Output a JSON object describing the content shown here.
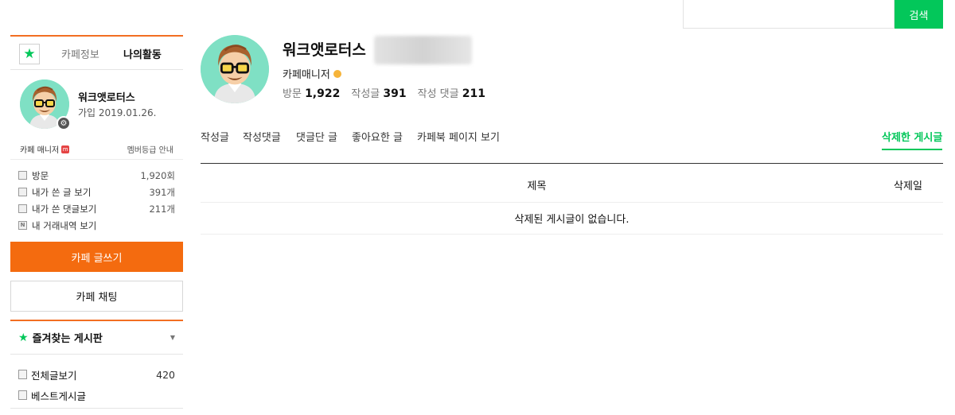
{
  "search": {
    "button_label": "검색",
    "placeholder": ""
  },
  "sidebar": {
    "tabs": {
      "info": "카페정보",
      "mine": "나의활동"
    },
    "profile": {
      "name": "워크앳로터스",
      "joined": "가입 2019.01.26.",
      "role": "카페 매니저",
      "grade_link": "멤버등급 안내"
    },
    "stats": [
      {
        "icon": "visit-icon",
        "label": "방문",
        "value": "1,920회"
      },
      {
        "icon": "post-icon",
        "label": "내가 쓴 글 보기",
        "value": "391개"
      },
      {
        "icon": "comment-icon",
        "label": "내가 쓴 댓글보기",
        "value": "211개"
      },
      {
        "icon": "trade-icon",
        "label": "내 거래내역 보기",
        "value": ""
      }
    ],
    "write_button": "카페 글쓰기",
    "chat_button": "카페 채팅",
    "favorites": {
      "label": "즐겨찾는 게시판"
    },
    "boards": [
      {
        "label": "전체글보기",
        "count": "420"
      },
      {
        "label": "베스트게시글",
        "count": ""
      }
    ]
  },
  "main": {
    "profile": {
      "name": "워크앳로터스",
      "role": "카페매니저",
      "visits_label": "방문",
      "visits": "1,922",
      "posts_label": "작성글",
      "posts": "391",
      "comments_label": "작성 댓글",
      "comments": "211"
    },
    "tabs": [
      {
        "label": "작성글"
      },
      {
        "label": "작성댓글"
      },
      {
        "label": "댓글단 글"
      },
      {
        "label": "좋아요한 글"
      },
      {
        "label": "카페북 페이지 보기"
      },
      {
        "label": "삭제한 게시글"
      }
    ],
    "table": {
      "col_title": "제목",
      "col_date": "삭제일",
      "empty_message": "삭제된 게시글이 없습니다."
    }
  },
  "colors": {
    "accent_green": "#03c75a",
    "accent_orange": "#f46b0f"
  }
}
